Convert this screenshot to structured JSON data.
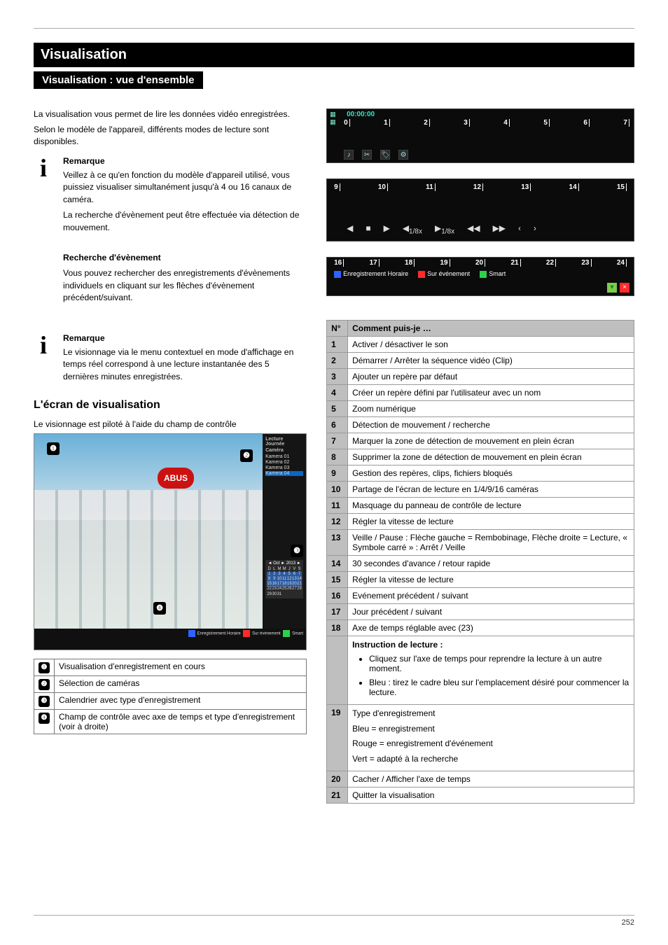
{
  "section": {
    "title": "Visualisation",
    "subtitle": "Visualisation : vue d'ensemble"
  },
  "intro": {
    "l1": "La visualisation vous permet de lire les données vidéo enregistrées.",
    "l2": "Selon le modèle de l'appareil, différents modes de lecture sont disponibles."
  },
  "note1": {
    "heading": "Remarque",
    "p1": "Veillez à ce qu'en fonction du modèle d'appareil utilisé, vous puissiez visualiser simultanément jusqu'à 4 ou 16 canaux de caméra.",
    "p2": "La recherche d'évènement peut être effectuée via détection de mouvement.",
    "title2": "Recherche d'évènement",
    "p3": "Vous pouvez rechercher des enregistrements d'évènements individuels en cliquant sur les flèches d'évènement précédent/suivant."
  },
  "note2": {
    "heading": "Remarque",
    "p1": "Le visionnage via le menu contextuel en mode d'affichage en temps réel correspond à une lecture instantanée des 5 dernières minutes enregistrées."
  },
  "screen": {
    "heading": "L'écran de visualisation",
    "lead": "Le visionnage est piloté à l'aide du champ de contrôle",
    "sidebar_title": "Lecture Journée",
    "cam_group": "Caméra",
    "cams": [
      "Kamera 01",
      "Kamera 02",
      "Kamera 03",
      "Kamera 04"
    ],
    "month": "Oct",
    "year": "2013",
    "dow": [
      "D",
      "L",
      "M",
      "M",
      "J",
      "V",
      "S"
    ],
    "tl_legend": [
      "Enregistrement Horaire",
      "Sur événement",
      "Smart"
    ],
    "logo": "ABUS"
  },
  "screen_table": {
    "r1": "Visualisation d'enregistrement en cours",
    "r2": "Sélection de caméras",
    "r3": "Calendrier avec type d'enregistrement",
    "r4": "Champ de contrôle avec axe de temps et type d'enregistrement (voir à droite)"
  },
  "fig1": {
    "timecode": "00:00:00",
    "ticks": [
      "0",
      "1",
      "2",
      "3",
      "4",
      "5",
      "6",
      "7"
    ]
  },
  "fig2": {
    "ticks": [
      "9",
      "10",
      "11",
      "12",
      "13",
      "14",
      "15"
    ],
    "sub": [
      "1/8x",
      "1/8x"
    ]
  },
  "fig3": {
    "ticks": [
      "16",
      "17",
      "18",
      "19",
      "20",
      "21",
      "22",
      "23",
      "24"
    ],
    "legend": [
      {
        "label": "Enregistrement Horaire",
        "color": "#2e63ff"
      },
      {
        "label": "Sur événement",
        "color": "#ff2b2b"
      },
      {
        "label": "Smart",
        "color": "#2bd24a"
      }
    ],
    "corner_a_color": "#7ecb4a",
    "corner_b_color": "#ff2b2b",
    "corner_b": "×"
  },
  "ctl": {
    "h1": "N°",
    "h2": "Comment puis-je …",
    "rows": [
      {
        "n": "1",
        "t": "Activer / désactiver le son"
      },
      {
        "n": "2",
        "t": "Démarrer / Arrêter la séquence vidéo (Clip)"
      },
      {
        "n": "3",
        "t": "Ajouter un repère par défaut"
      },
      {
        "n": "4",
        "t": "Créer un repère défini par l'utilisateur avec un nom"
      },
      {
        "n": "5",
        "t": "Zoom numérique"
      },
      {
        "n": "6",
        "t": "Détection de mouvement / recherche"
      },
      {
        "n": "7",
        "t": "Marquer la zone de détection de mouvement en plein écran"
      },
      {
        "n": "8",
        "t": "Supprimer la zone de détection de mouvement en plein écran"
      },
      {
        "n": "9",
        "t": "Gestion des repères, clips, fichiers bloqués"
      },
      {
        "n": "10",
        "t": "Partage de l'écran de lecture en 1/4/9/16 caméras"
      },
      {
        "n": "11",
        "t": "Masquage du panneau de contrôle de lecture"
      },
      {
        "n": "12",
        "t": "Régler la vitesse de lecture"
      },
      {
        "n": "13",
        "t": "Veille / Pause : Flèche gauche = Rembobinage, Flèche droite = Lecture, « Symbole carré » : Arrêt / Veille"
      },
      {
        "n": "14",
        "t": "30 secondes d'avance / retour rapide"
      },
      {
        "n": "15",
        "t": "Régler la vitesse de lecture"
      },
      {
        "n": "16",
        "t": "Evénement précédent / suivant"
      },
      {
        "n": "17",
        "t": "Jour précédent / suivant"
      },
      {
        "n": "18",
        "t": "Axe de temps réglable avec (23)"
      }
    ],
    "inst_title": "Instruction de lecture :",
    "inst1": "Cliquez sur l'axe de temps pour reprendre la lecture à un autre moment.",
    "inst2": "Bleu : tirez le cadre bleu sur l'emplacement désiré pour commencer la lecture.",
    "n19": "19",
    "r19a": "Type d'enregistrement",
    "r19b": "Bleu = enregistrement",
    "r19c": "Rouge = enregistrement d'événement",
    "r19d": "Vert = adapté à la recherche",
    "n20": "20",
    "r20": "Cacher / Afficher l'axe de temps",
    "n21": "21",
    "r21": "Quitter la visualisation"
  },
  "footer": "252"
}
